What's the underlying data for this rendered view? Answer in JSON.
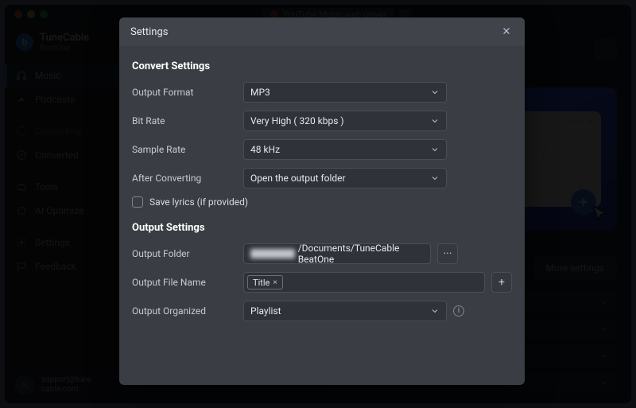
{
  "window": {
    "tab_title": "YouTube Music web player"
  },
  "brand": {
    "name": "TuneCable",
    "sub": "BeatOne",
    "logo_letter": "b",
    "accent": "#1f8fff"
  },
  "sidebar": {
    "items": [
      {
        "label": "Music"
      },
      {
        "label": "Podcasts"
      },
      {
        "label": "Converting"
      },
      {
        "label": "Converted"
      },
      {
        "label": "Tools"
      },
      {
        "label": "AI Optimize"
      },
      {
        "label": "Settings"
      },
      {
        "label": "Feedback"
      }
    ],
    "support_line1": "support@tune",
    "support_line2": "cable.com"
  },
  "main": {
    "more_settings": "More settings",
    "hero_dots": "• • •",
    "hero_plus": "+"
  },
  "modal": {
    "title": "Settings",
    "section_convert": "Convert Settings",
    "section_output": "Output Settings",
    "labels": {
      "output_format": "Output Format",
      "bit_rate": "Bit Rate",
      "sample_rate": "Sample Rate",
      "after_converting": "After Converting",
      "save_lyrics": "Save lyrics (if provided)",
      "output_folder": "Output Folder",
      "output_file_name": "Output File Name",
      "output_organized": "Output Organized"
    },
    "values": {
      "output_format": "MP3",
      "bit_rate": "Very High ( 320 kbps )",
      "sample_rate": "48 kHz",
      "after_converting": "Open the output folder",
      "save_lyrics_checked": false,
      "output_folder_visible": "/Documents/TuneCable BeatOne",
      "file_name_tag": "Title",
      "output_organized": "Playlist"
    },
    "buttons": {
      "browse": "···",
      "add_tag": "+"
    }
  }
}
